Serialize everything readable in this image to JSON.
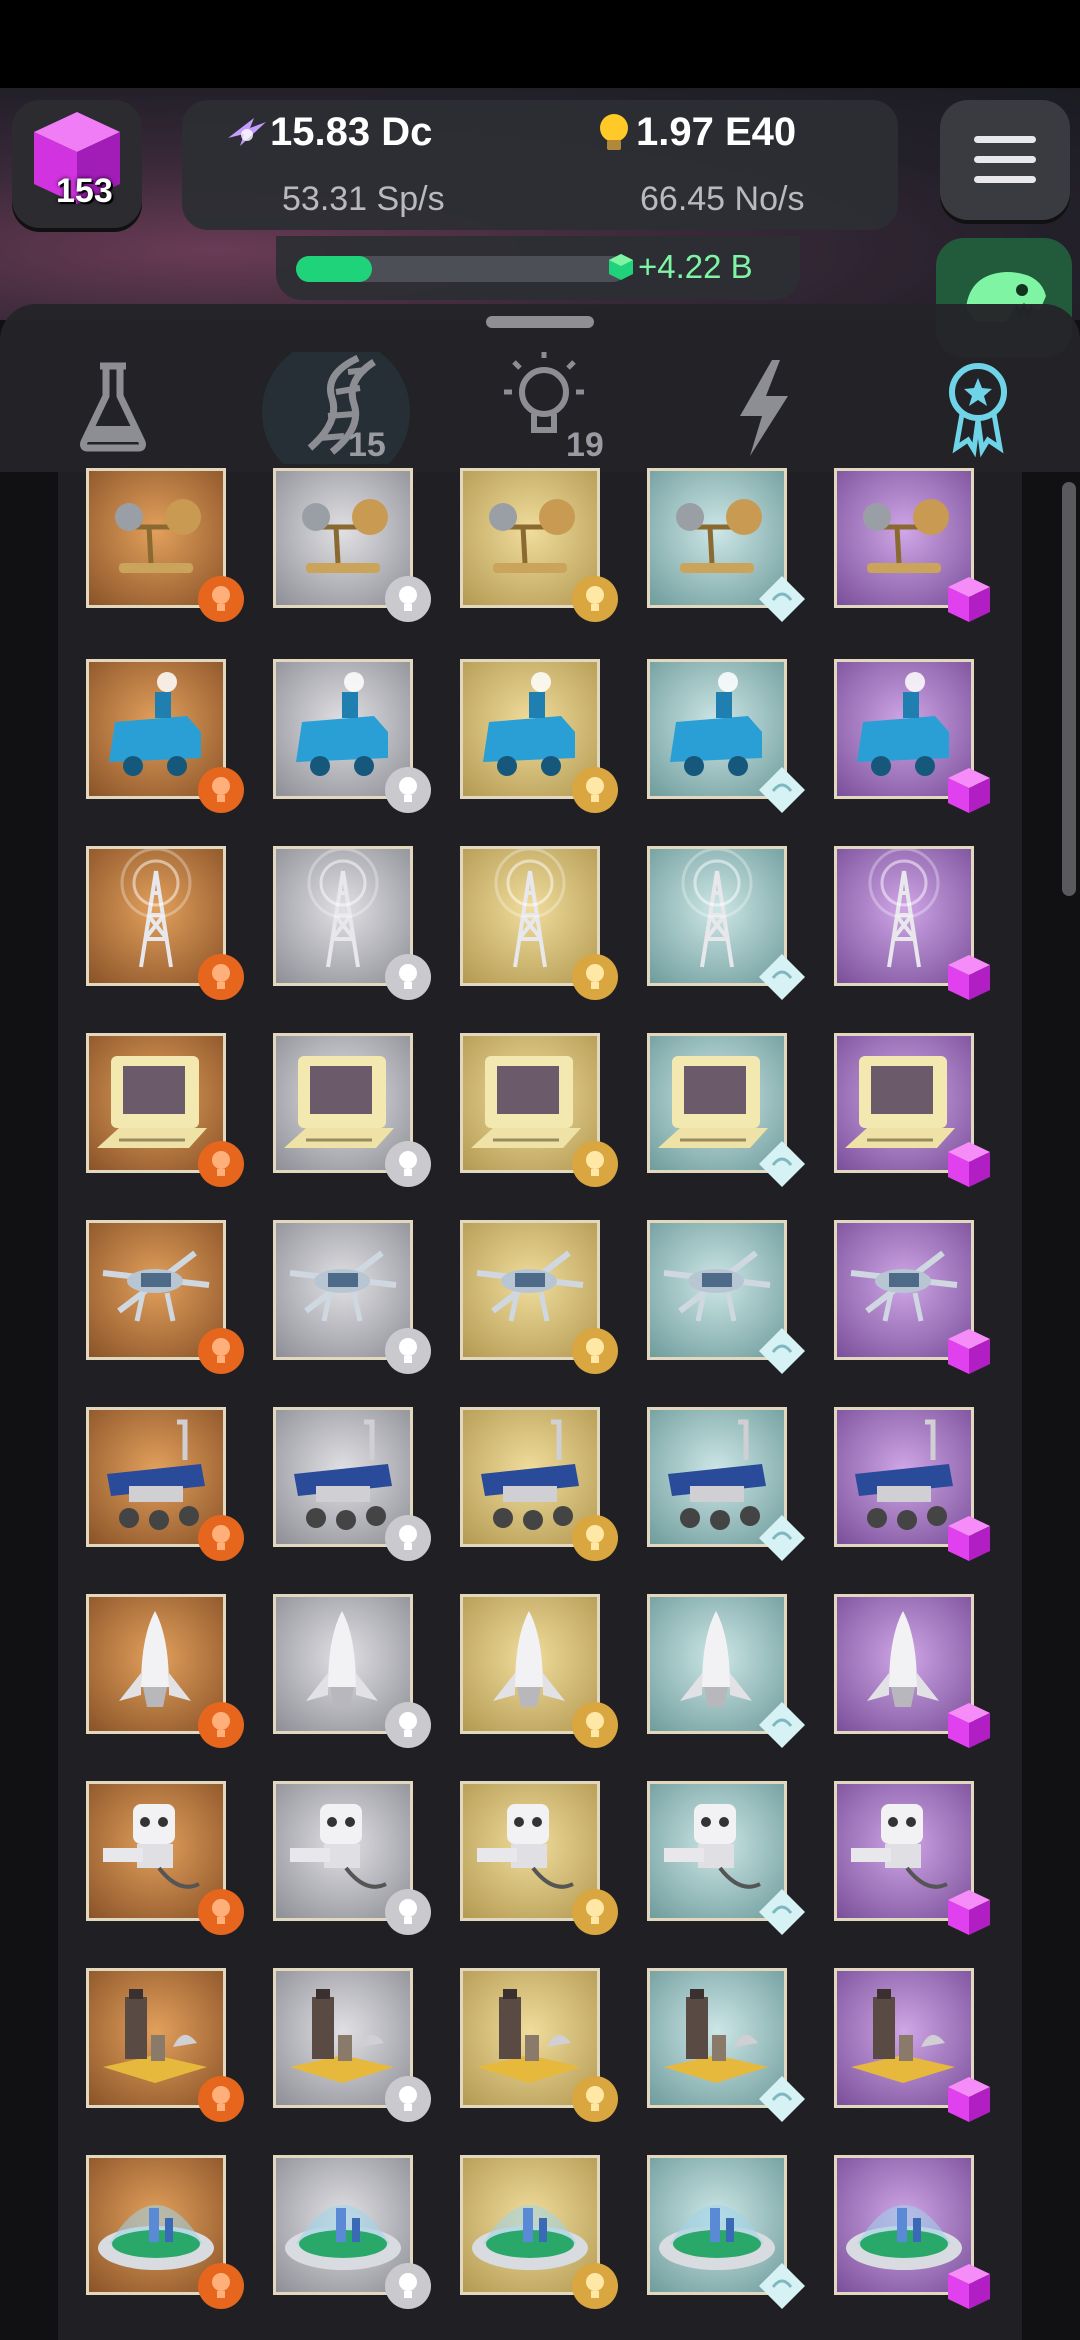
{
  "header": {
    "cubes": "153",
    "resource1": {
      "value": "15.83 Dc",
      "rate": "53.31 Sp/s",
      "icon": "science-bolt-icon"
    },
    "resource2": {
      "value": "1.97 E40",
      "rate": "66.45 No/s",
      "icon": "lightbulb-icon"
    },
    "progress": {
      "label": "+4.22 B",
      "fraction": 0.23
    }
  },
  "tabs": [
    {
      "id": "lab",
      "icon": "flask-icon",
      "badge": ""
    },
    {
      "id": "dna",
      "icon": "dna-icon",
      "badge": "15"
    },
    {
      "id": "ideas",
      "icon": "lightbulb-icon",
      "badge": "19"
    },
    {
      "id": "power",
      "icon": "lightning-icon",
      "badge": ""
    },
    {
      "id": "awards",
      "icon": "award-ribbon-icon",
      "badge": "",
      "active": true
    }
  ],
  "tiers": [
    {
      "name": "bronze",
      "bg1": "#e2a05c",
      "bg2": "#8a5328",
      "badge": "bronze-bulb-badge",
      "badge_color": "#e5661c"
    },
    {
      "name": "silver",
      "bg1": "#e0e0e4",
      "bg2": "#8e8f96",
      "badge": "silver-bulb-badge",
      "badge_color": "#c9c9ce"
    },
    {
      "name": "gold",
      "bg1": "#f0dc9c",
      "bg2": "#b39a52",
      "badge": "gold-bulb-badge",
      "badge_color": "#d9a640"
    },
    {
      "name": "diamond",
      "bg1": "#cde6e6",
      "bg2": "#6f9c9c",
      "badge": "diamond-badge",
      "badge_color": "#d6f2f4"
    },
    {
      "name": "cube",
      "bg1": "#cfa6e6",
      "bg2": "#7a4f9a",
      "badge": "pink-cube-badge",
      "badge_color": "#e040ee"
    }
  ],
  "rows": [
    {
      "item": "orrery",
      "icon": "orrery-icon"
    },
    {
      "item": "steam-locomotive",
      "icon": "locomotive-icon"
    },
    {
      "item": "radio-tower",
      "icon": "radio-tower-icon"
    },
    {
      "item": "retro-computer",
      "icon": "computer-icon"
    },
    {
      "item": "drone",
      "icon": "drone-icon"
    },
    {
      "item": "mars-rover",
      "icon": "rover-icon"
    },
    {
      "item": "space-shuttle",
      "icon": "shuttle-icon"
    },
    {
      "item": "robot-arm",
      "icon": "robot-icon"
    },
    {
      "item": "colony-base",
      "icon": "base-icon"
    },
    {
      "item": "biodome",
      "icon": "biodome-icon"
    }
  ]
}
